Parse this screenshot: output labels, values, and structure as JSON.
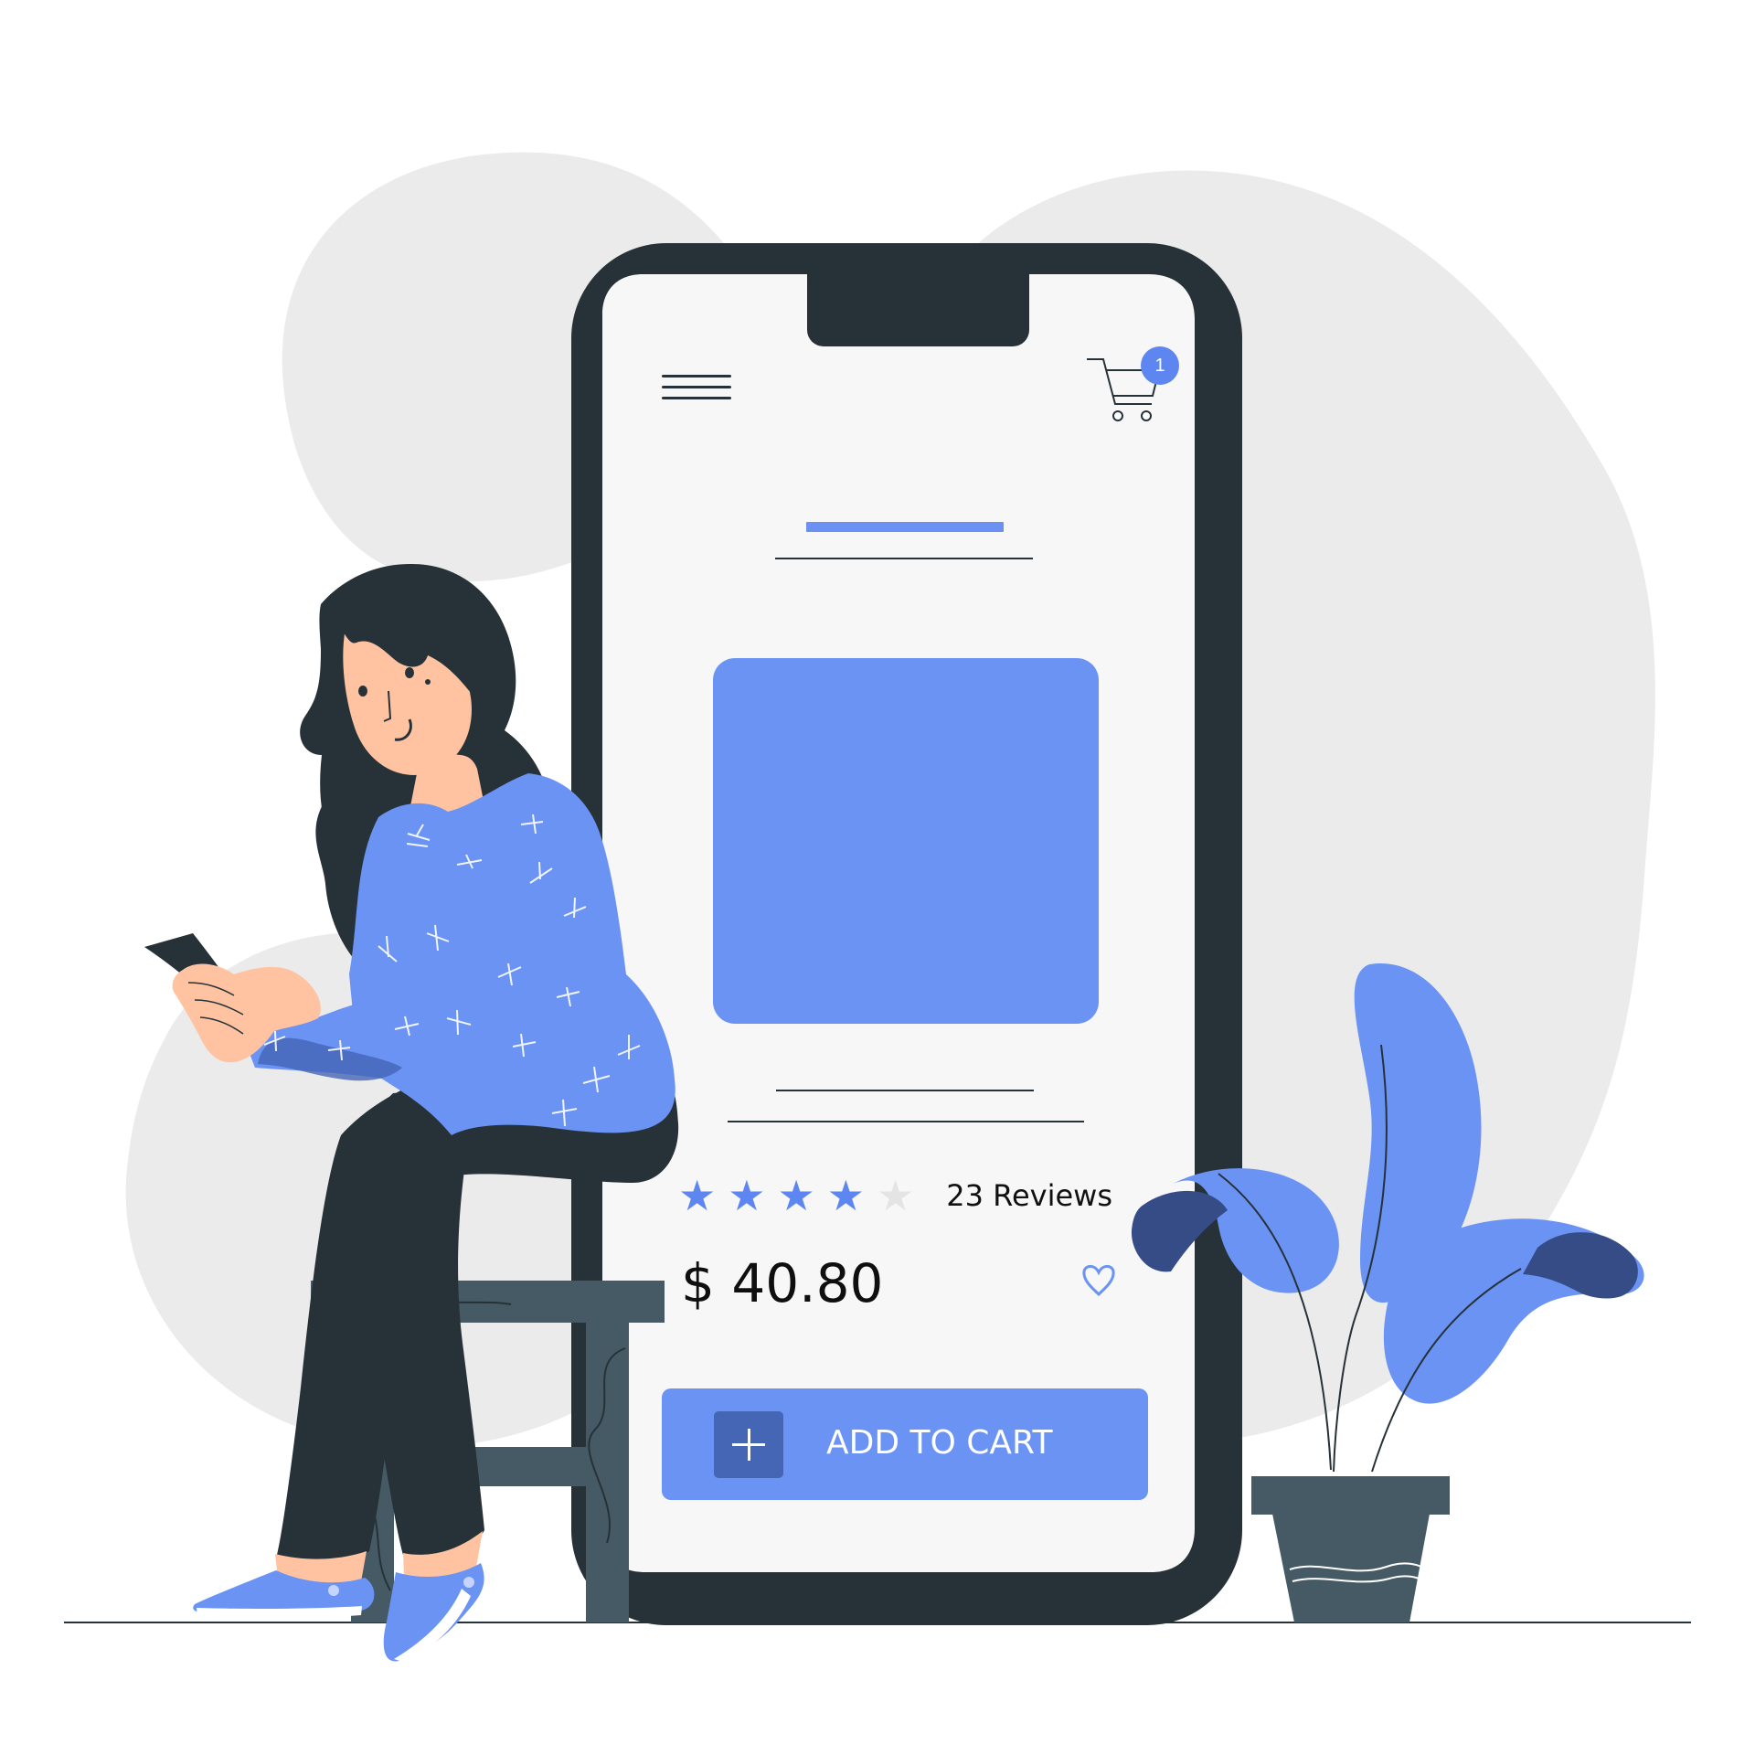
{
  "app": {
    "screen": "product-detail"
  },
  "header": {
    "menu_icon": "menu-icon",
    "cart_icon": "shopping-cart-icon",
    "cart_count": "1"
  },
  "product": {
    "image_icon": "armchair-icon",
    "rating": 4,
    "rating_max": 5,
    "rating_stars": [
      "★",
      "★",
      "★",
      "★",
      "★"
    ],
    "review_count": "23 Reviews",
    "price": "$ 40.80",
    "favorite_icon": "heart-outline-icon"
  },
  "actions": {
    "add_icon": "plus-icon",
    "add_to_cart_label": "ADD TO CART"
  },
  "colors": {
    "accent": "#6A93F3",
    "accent_dark": "#4565B5",
    "plant_dark": "#364C86",
    "phone_frame": "#263238",
    "screen": "#F7F7F7",
    "background_blob": "#EBEBEB",
    "skin": "#FFC3A2",
    "pants": "#263238",
    "chair": "#455A64"
  }
}
